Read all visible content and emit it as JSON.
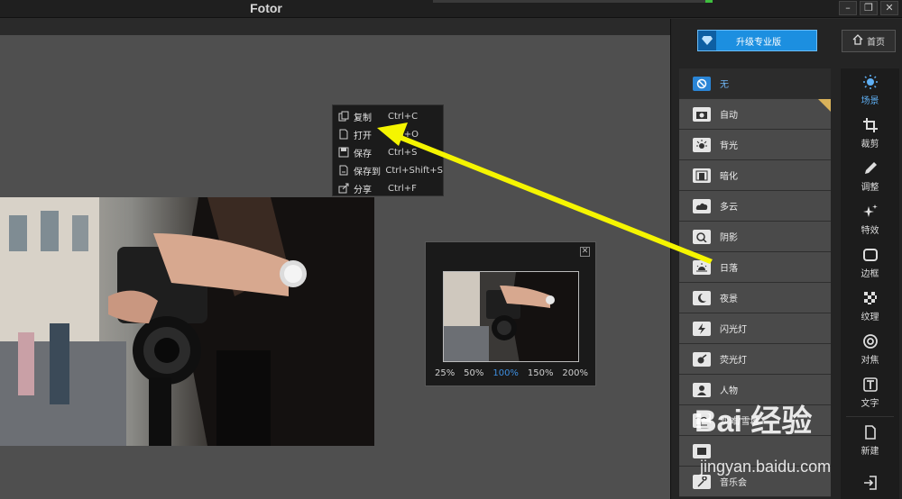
{
  "window": {
    "title": "Fotor",
    "minimize": "–",
    "restore": "❐",
    "close": "✕"
  },
  "context_menu": {
    "items": [
      {
        "label": "复制",
        "shortcut": "Ctrl+C",
        "icon": "copy-icon"
      },
      {
        "label": "打开",
        "shortcut": "Ctrl+O",
        "icon": "open-file-icon"
      },
      {
        "label": "保存",
        "shortcut": "Ctrl+S",
        "icon": "save-icon"
      },
      {
        "label": "保存到",
        "shortcut": "Ctrl+Shift+S",
        "icon": "save-as-icon"
      },
      {
        "label": "分享",
        "shortcut": "Ctrl+F",
        "icon": "share-icon"
      }
    ]
  },
  "zoom_panel": {
    "close": "✕",
    "levels": [
      "25%",
      "50%",
      "100%",
      "150%",
      "200%"
    ],
    "active_level": "100%"
  },
  "header": {
    "upgrade_label": "升级专业版",
    "home_label": "首页"
  },
  "scenes": [
    {
      "label": "无",
      "icon": "none-icon",
      "selected": true
    },
    {
      "label": "自动",
      "icon": "camera-icon",
      "pro": true
    },
    {
      "label": "背光",
      "icon": "backlight-icon"
    },
    {
      "label": "暗化",
      "icon": "darken-icon"
    },
    {
      "label": "多云",
      "icon": "cloud-icon"
    },
    {
      "label": "阴影",
      "icon": "shadow-icon"
    },
    {
      "label": "日落",
      "icon": "sunset-icon"
    },
    {
      "label": "夜景",
      "icon": "night-icon"
    },
    {
      "label": "闪光灯",
      "icon": "flash-icon"
    },
    {
      "label": "荧光灯",
      "icon": "fluorescent-icon"
    },
    {
      "label": "人物",
      "icon": "portrait-icon"
    },
    {
      "label": "沙滩/雪地",
      "icon": "beach-icon"
    },
    {
      "label": "",
      "icon": "scene-icon"
    },
    {
      "label": "音乐会",
      "icon": "concert-icon"
    }
  ],
  "tools": [
    {
      "label": "场景",
      "icon": "scene-sun-icon",
      "active": true
    },
    {
      "label": "裁剪",
      "icon": "crop-icon"
    },
    {
      "label": "调整",
      "icon": "adjust-pen-icon"
    },
    {
      "label": "特效",
      "icon": "effects-sparkle-icon"
    },
    {
      "label": "边框",
      "icon": "frame-icon"
    },
    {
      "label": "纹理",
      "icon": "texture-icon"
    },
    {
      "label": "对焦",
      "icon": "focus-icon"
    },
    {
      "label": "文字",
      "icon": "text-icon"
    },
    {
      "label": "新建",
      "icon": "new-file-icon"
    },
    {
      "label": "",
      "icon": "export-icon"
    }
  ],
  "watermark": {
    "line1": "Bai 经验",
    "line2": "jingyan.baidu.com"
  },
  "colors": {
    "accent": "#1c8fe0",
    "annotation_arrow": "#f5f500",
    "canvas_bg": "#4f4f4f"
  }
}
